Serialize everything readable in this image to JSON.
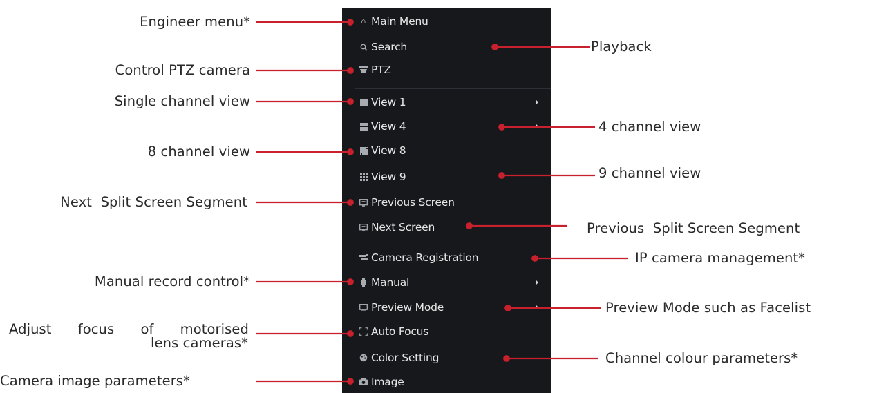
{
  "menu": {
    "items": [
      {
        "label": "Main Menu",
        "icon": "home-icon"
      },
      {
        "label": "Search",
        "icon": "search-icon"
      },
      {
        "label": "PTZ",
        "icon": "ptz-camera-icon"
      },
      {
        "label": "View 1",
        "icon": "view-1-icon"
      },
      {
        "label": "View 4",
        "icon": "view-4-icon"
      },
      {
        "label": "View 8",
        "icon": "view-8-icon"
      },
      {
        "label": "View 9",
        "icon": "view-9-icon"
      },
      {
        "label": "Previous Screen",
        "icon": "previous-screen-icon"
      },
      {
        "label": "Next Screen",
        "icon": "next-screen-icon"
      },
      {
        "label": "Camera Registration",
        "icon": "camera-registration-icon"
      },
      {
        "label": "Manual",
        "icon": "manual-record-icon"
      },
      {
        "label": "Preview Mode",
        "icon": "preview-mode-icon"
      },
      {
        "label": "Auto Focus",
        "icon": "auto-focus-icon"
      },
      {
        "label": "Color Setting",
        "icon": "color-setting-icon"
      },
      {
        "label": "Image",
        "icon": "image-icon"
      }
    ]
  },
  "annotations": {
    "left": [
      "Engineer menu*",
      "Control PTZ camera",
      "Single channel view",
      "8 channel view",
      "Next  Split Screen Segment",
      "Manual record control*",
      "Adjust  focus  of  motorised",
      "lens cameras*",
      "Camera image parameters*"
    ],
    "right": [
      "Playback",
      "4 channel view",
      "9 channel view",
      "Previous  Split Screen Segment",
      "IP camera management*",
      "Preview Mode such as Facelist",
      "Channel colour parameters*"
    ]
  },
  "colors": {
    "menu_background": "#16181c",
    "menu_text": "#e6e6e6",
    "leader_line": "#c8202c",
    "annotation_text": "#2a2a2a"
  }
}
